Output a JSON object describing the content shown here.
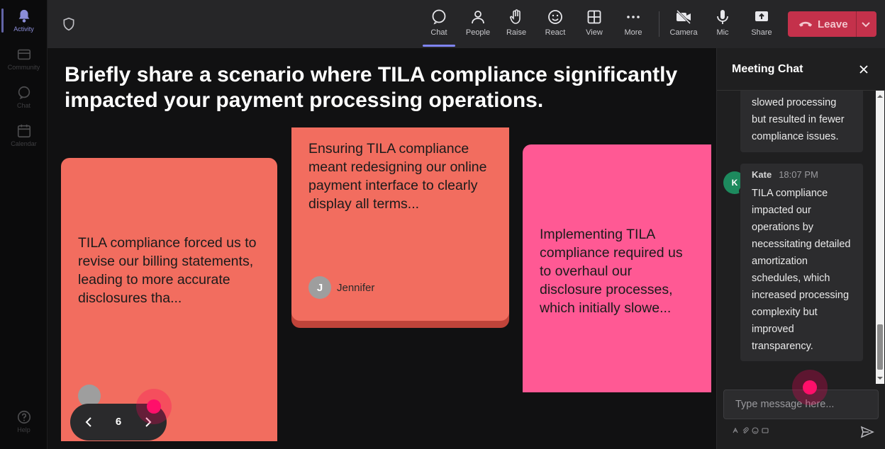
{
  "rail": {
    "items": [
      {
        "label": "Activity",
        "icon": "bell-icon"
      },
      {
        "label": "Community",
        "icon": "community-icon"
      },
      {
        "label": "Chat",
        "icon": "chat-icon"
      },
      {
        "label": "Calendar",
        "icon": "calendar-icon"
      },
      {
        "label": "Help",
        "icon": "help-icon"
      }
    ]
  },
  "toolbar": {
    "chat": "Chat",
    "people": "People",
    "raise": "Raise",
    "react": "React",
    "view": "View",
    "more": "More",
    "camera": "Camera",
    "mic": "Mic",
    "share": "Share",
    "leave": "Leave"
  },
  "stage": {
    "question": "Briefly share a scenario where TILA compliance significantly impacted your payment processing operations.",
    "cards": [
      {
        "text": "TILA compliance forced us to revise our billing statements, leading to more accurate disclosures tha..."
      },
      {
        "text": "Ensuring TILA compliance meant redesigning our online payment interface to clearly display all terms...",
        "author_initial": "J",
        "author_name": "Jennifer"
      },
      {
        "text": "Implementing TILA compliance required us to overhaul our disclosure processes, which initially slowe..."
      }
    ],
    "pager": {
      "page": "6"
    }
  },
  "chat": {
    "title": "Meeting Chat",
    "messages": [
      {
        "text": "slowed processing but resulted in fewer compliance issues."
      },
      {
        "initial": "K",
        "sender": "Kate",
        "time": "18:07 PM",
        "text": "TILA compliance impacted our operations by necessitating detailed amortization schedules, which increased processing complexity but improved transparency."
      }
    ],
    "input_placeholder": "Type message here..."
  },
  "colors": {
    "accent": "#7f85f5",
    "leave": "#c4314b",
    "card_coral": "#f26d5f",
    "card_pink": "#ff5994",
    "cursor": "#ff0f6a"
  }
}
